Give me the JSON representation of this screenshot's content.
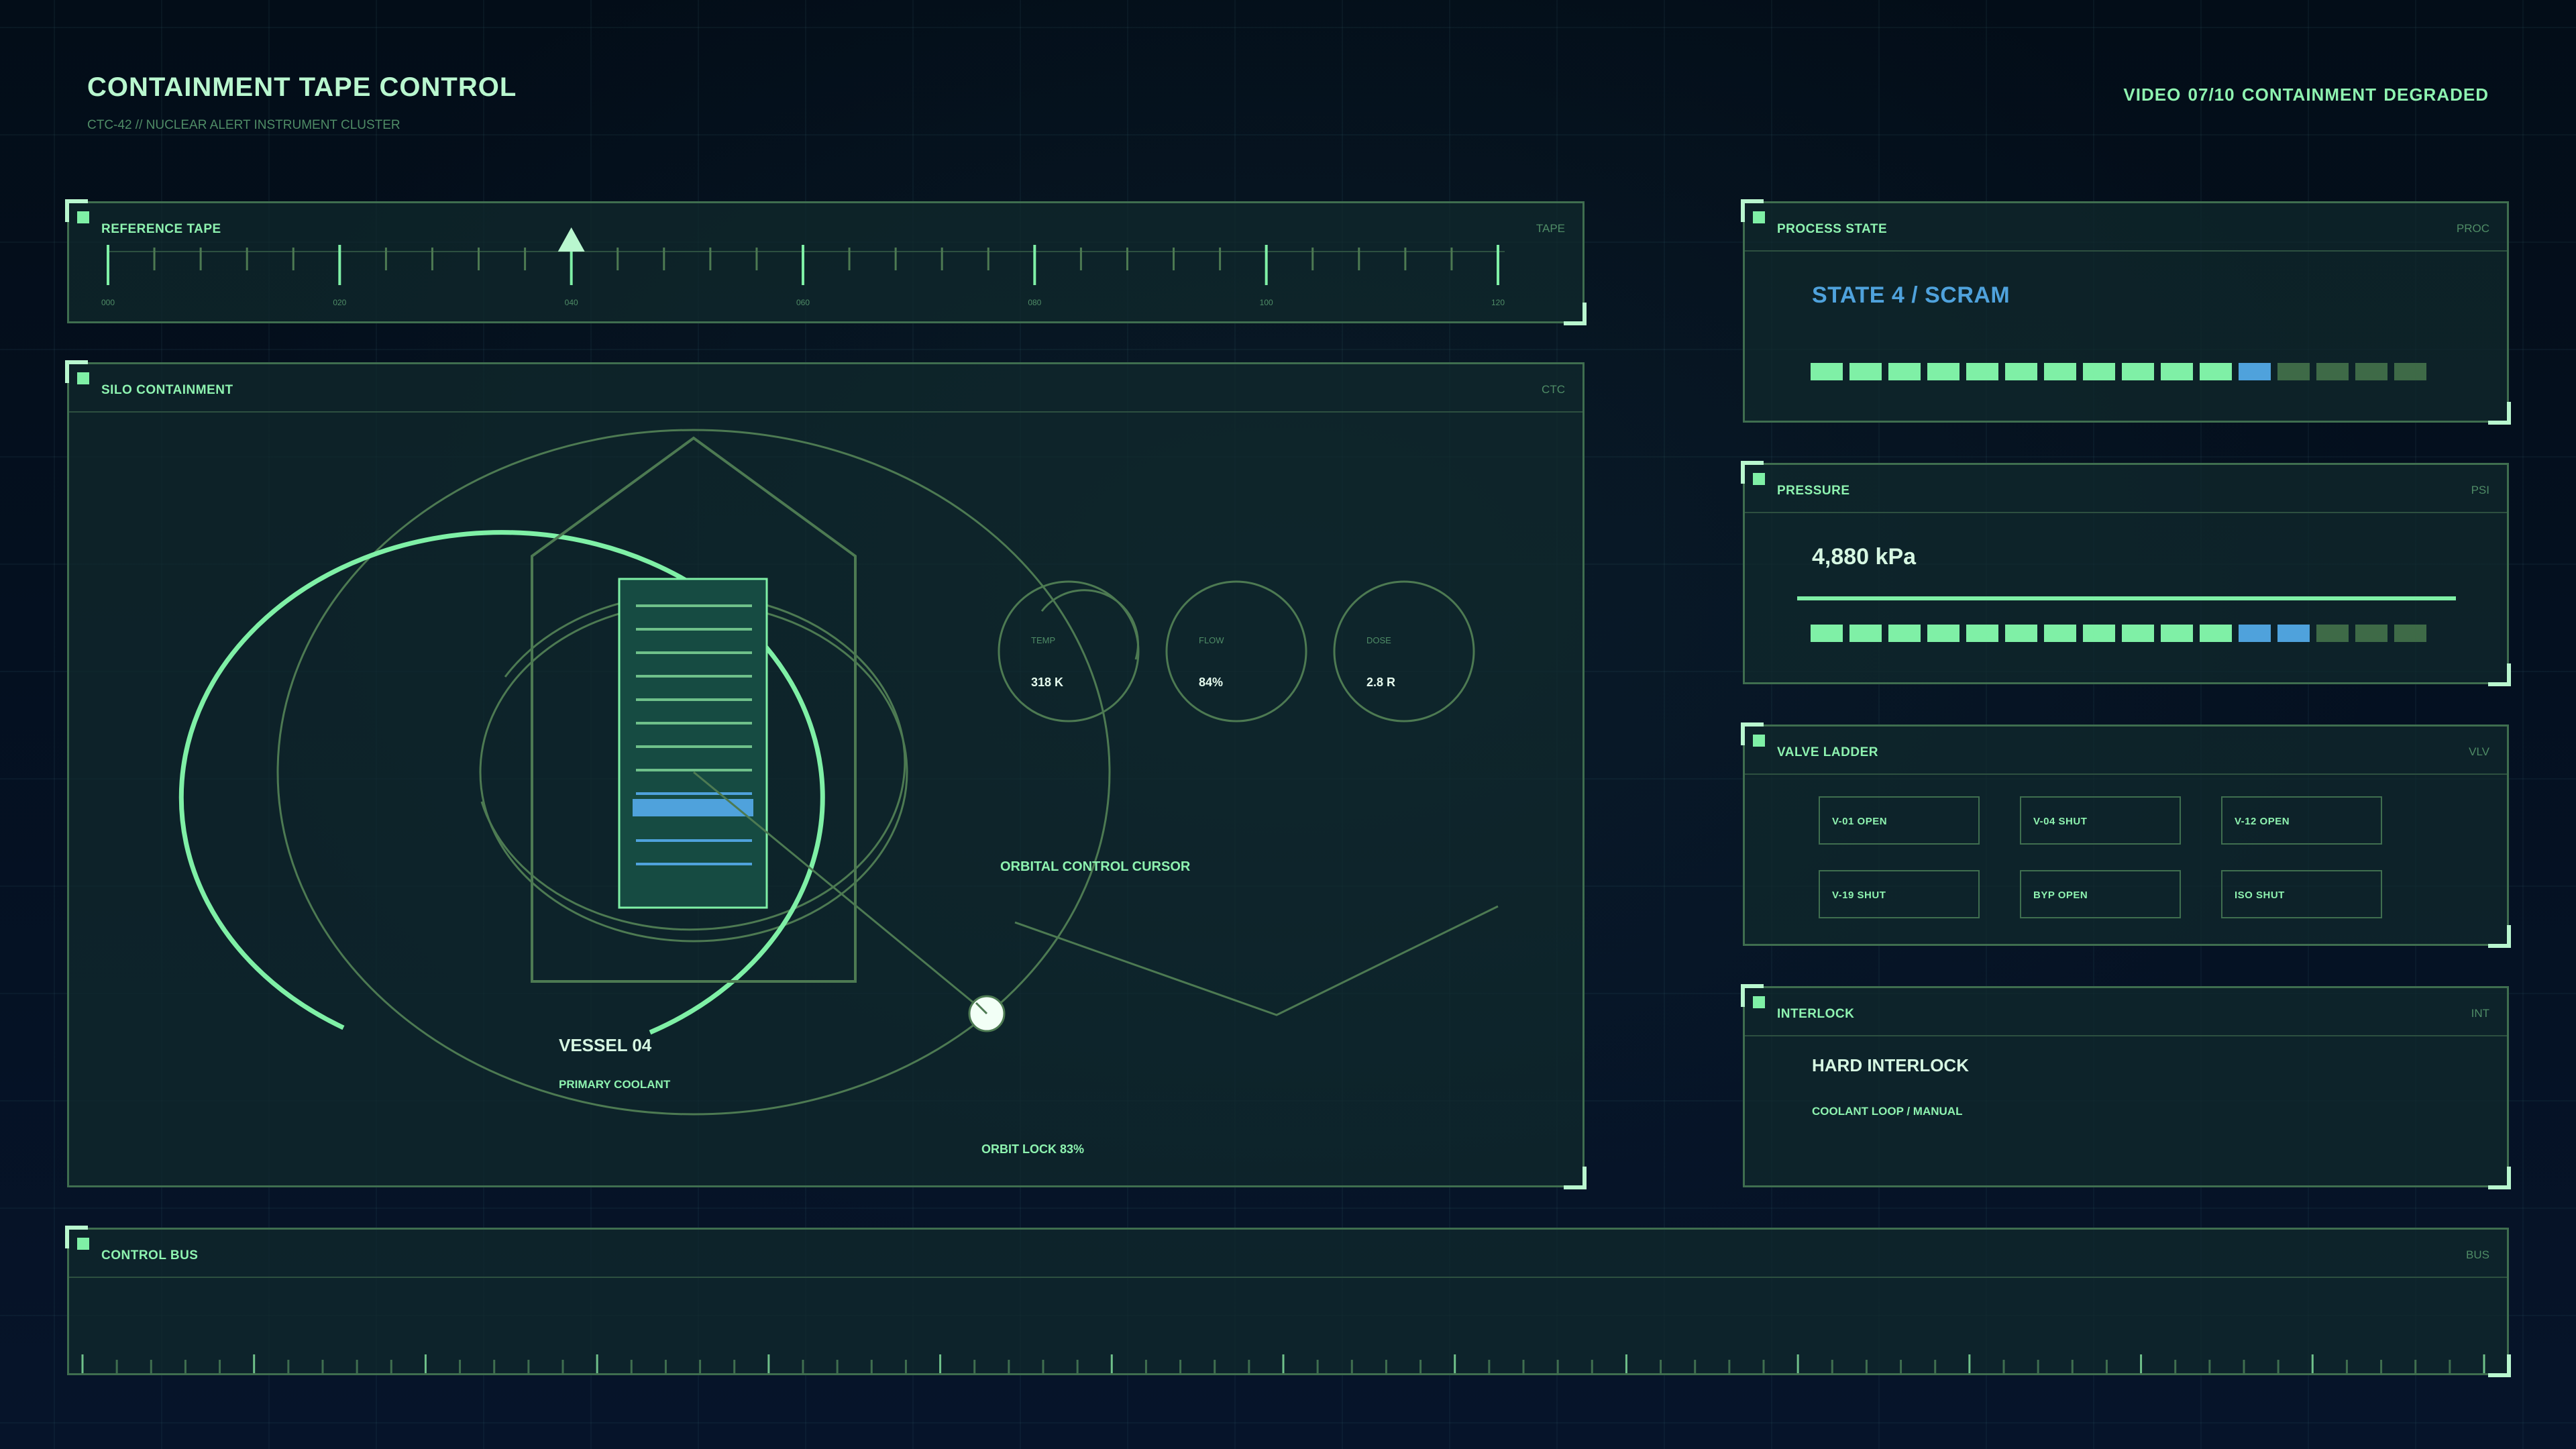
{
  "header": {
    "title": "CONTAINMENT TAPE CONTROL",
    "subtitle": "CTC-42 // NUCLEAR ALERT INSTRUMENT CLUSTER",
    "status": "VIDEO 07/10  CONTAINMENT DEGRADED"
  },
  "reference_tape": {
    "title": "REFERENCE TAPE",
    "tag": "TAPE",
    "tick_labels": [
      "000",
      "020",
      "040",
      "060",
      "080",
      "100",
      "120"
    ],
    "marker_value": 40
  },
  "silo": {
    "title": "SILO CONTAINMENT",
    "tag": "CTC",
    "vessel_label": "VESSEL 04",
    "vessel_sublabel": "PRIMARY COOLANT",
    "cursor_label": "ORBITAL CONTROL CURSOR",
    "orbit_lock": "ORBIT LOCK 83%",
    "gauges": [
      {
        "label": "TEMP",
        "value": "318 K"
      },
      {
        "label": "FLOW",
        "value": "84%"
      },
      {
        "label": "DOSE",
        "value": "2.8 R"
      }
    ]
  },
  "process_state": {
    "title": "PROCESS STATE",
    "tag": "PROC",
    "value": "STATE 4 / SCRAM",
    "segments": [
      "on",
      "on",
      "on",
      "on",
      "on",
      "on",
      "on",
      "on",
      "on",
      "on",
      "on",
      "blue",
      "dim",
      "dim",
      "dim",
      "dim"
    ]
  },
  "pressure": {
    "title": "PRESSURE",
    "tag": "PSI",
    "value": "4,880 kPa",
    "segments": [
      "on",
      "on",
      "on",
      "on",
      "on",
      "on",
      "on",
      "on",
      "on",
      "on",
      "on",
      "blue",
      "blue",
      "dim",
      "dim",
      "dim"
    ]
  },
  "valve_ladder": {
    "title": "VALVE LADDER",
    "tag": "VLV",
    "valves": [
      "V-01 OPEN",
      "V-04 SHUT",
      "V-12 OPEN",
      "V-19 SHUT",
      "BYP OPEN",
      "ISO SHUT"
    ]
  },
  "interlock": {
    "title": "INTERLOCK",
    "tag": "INT",
    "value": "HARD INTERLOCK",
    "detail": "COOLANT LOOP / MANUAL"
  },
  "control_bus": {
    "title": "CONTROL BUS",
    "tag": "BUS"
  },
  "colors": {
    "accent": "#7ff0a6",
    "accent_light": "#b9f7cf",
    "alert_blue": "#4fa2dc",
    "dim": "#3e6a47",
    "panel_border": "#3f6e4f",
    "background": "#04101c"
  }
}
